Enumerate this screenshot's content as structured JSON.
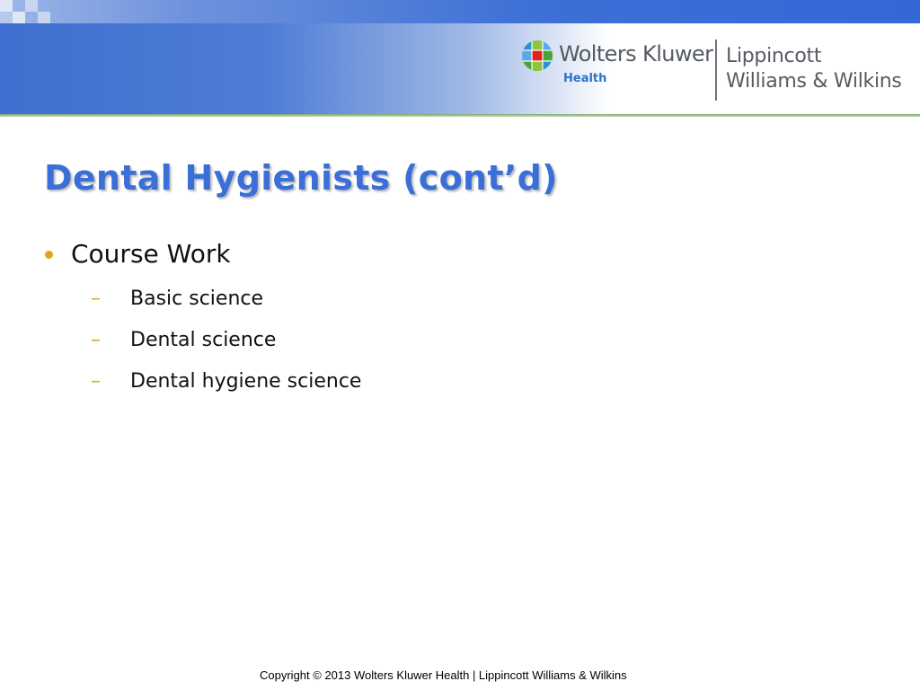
{
  "header": {
    "brand_name": "Wolters Kluwer",
    "brand_division": "Health",
    "imprint_line1": "Lippincott",
    "imprint_line2": "Williams & Wilkins"
  },
  "slide": {
    "title": "Dental Hygienists (cont’d)",
    "bullets": [
      {
        "text": "Course Work",
        "sub_items": [
          "Basic science",
          "Dental science",
          "Dental hygiene science"
        ]
      }
    ],
    "sub_marker": "–"
  },
  "footer": {
    "copyright": "Copyright © 2013 Wolters Kluwer Health | Lippincott Williams & Wilkins"
  },
  "colors": {
    "title": "#3a6fd8",
    "bullet_accent": "#e0a51a",
    "header_blue": "#3468d6",
    "header_rule": "#7fa86a"
  },
  "icons": [
    "logo-globe-icon"
  ]
}
